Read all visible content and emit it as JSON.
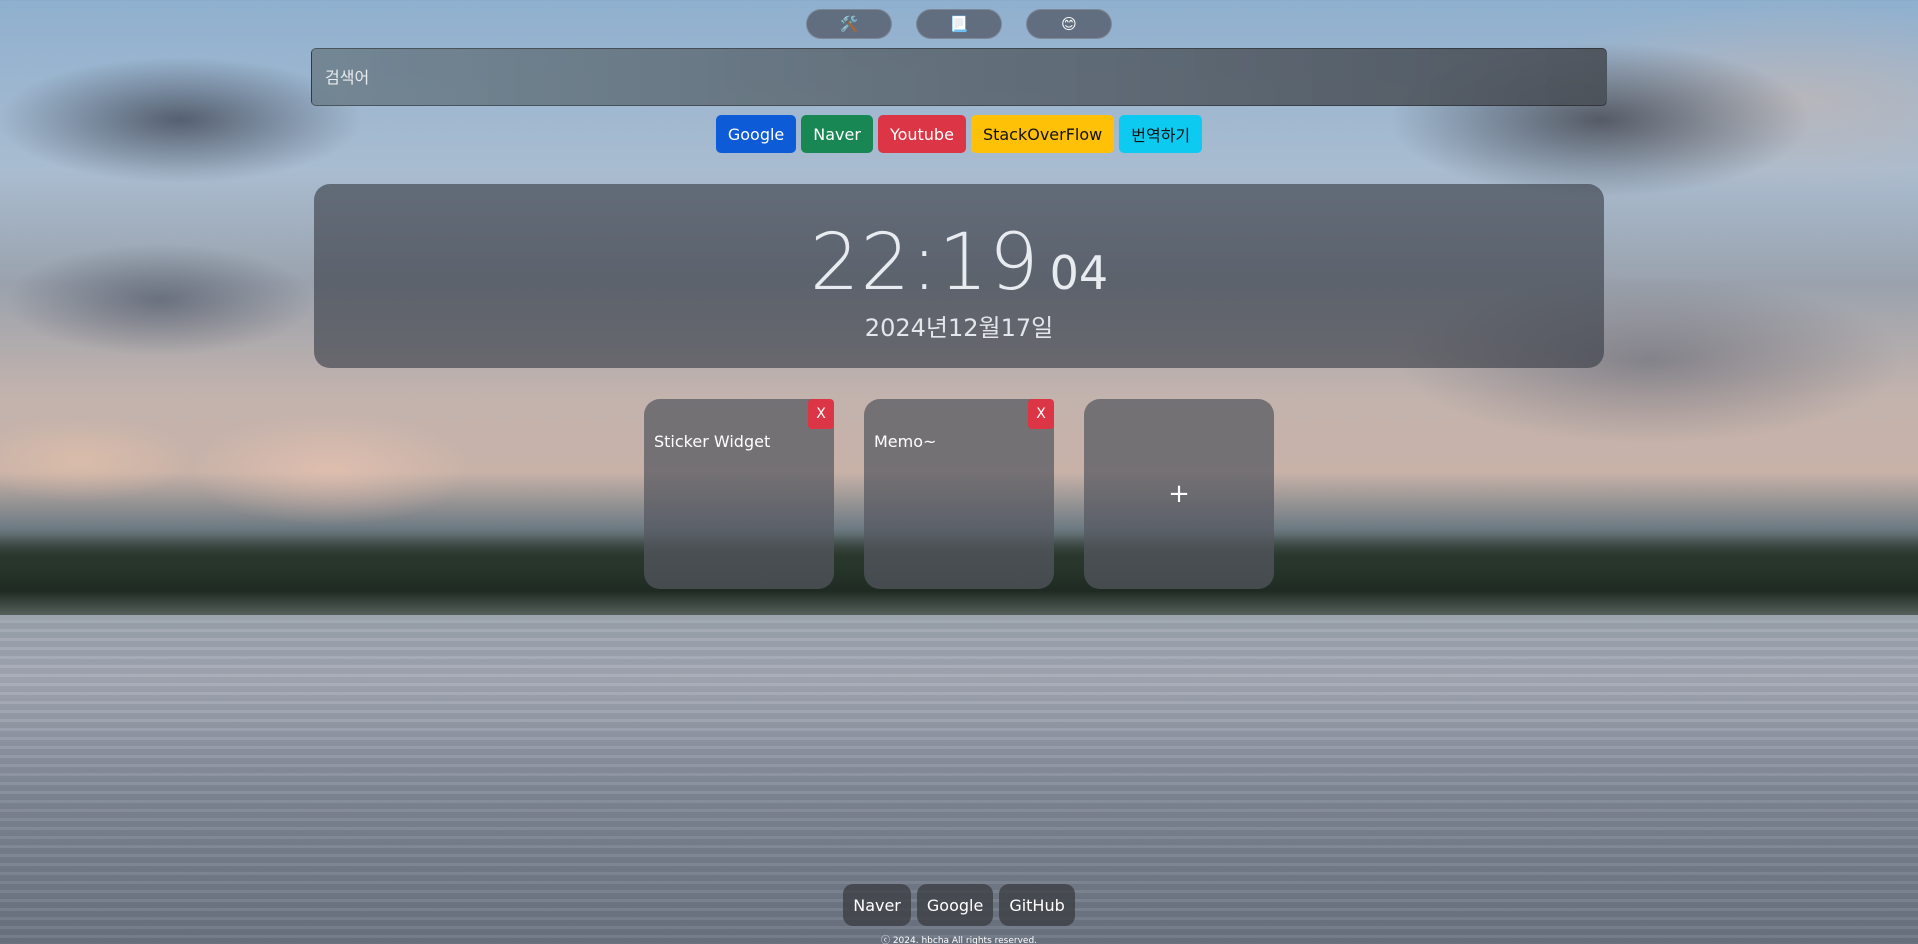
{
  "quick_buttons": [
    {
      "icon": "tools-icon",
      "glyph": "🛠️"
    },
    {
      "icon": "memo-icon",
      "glyph": "📃"
    },
    {
      "icon": "smile-icon",
      "glyph": "😊"
    }
  ],
  "search": {
    "placeholder": "검색어",
    "value": ""
  },
  "engines": [
    {
      "label": "Google",
      "color": "#0d5bd6"
    },
    {
      "label": "Naver",
      "color": "#198754"
    },
    {
      "label": "Youtube",
      "color": "#dc3545"
    },
    {
      "label": "StackOverFlow",
      "color": "#ffc107"
    },
    {
      "label": "번역하기",
      "color": "#0dcaf0"
    }
  ],
  "clock": {
    "time": "22:19",
    "seconds": "04",
    "date": "2024년12월17일"
  },
  "widgets": [
    {
      "title": "Sticker Widget",
      "close": "X"
    },
    {
      "title": "Memo~",
      "close": "X"
    }
  ],
  "add_widget": {
    "label": "+"
  },
  "footer": {
    "links": [
      "Naver",
      "Google",
      "GitHub"
    ],
    "copyright": "ⓒ 2024. hbcha All rights reserved."
  }
}
